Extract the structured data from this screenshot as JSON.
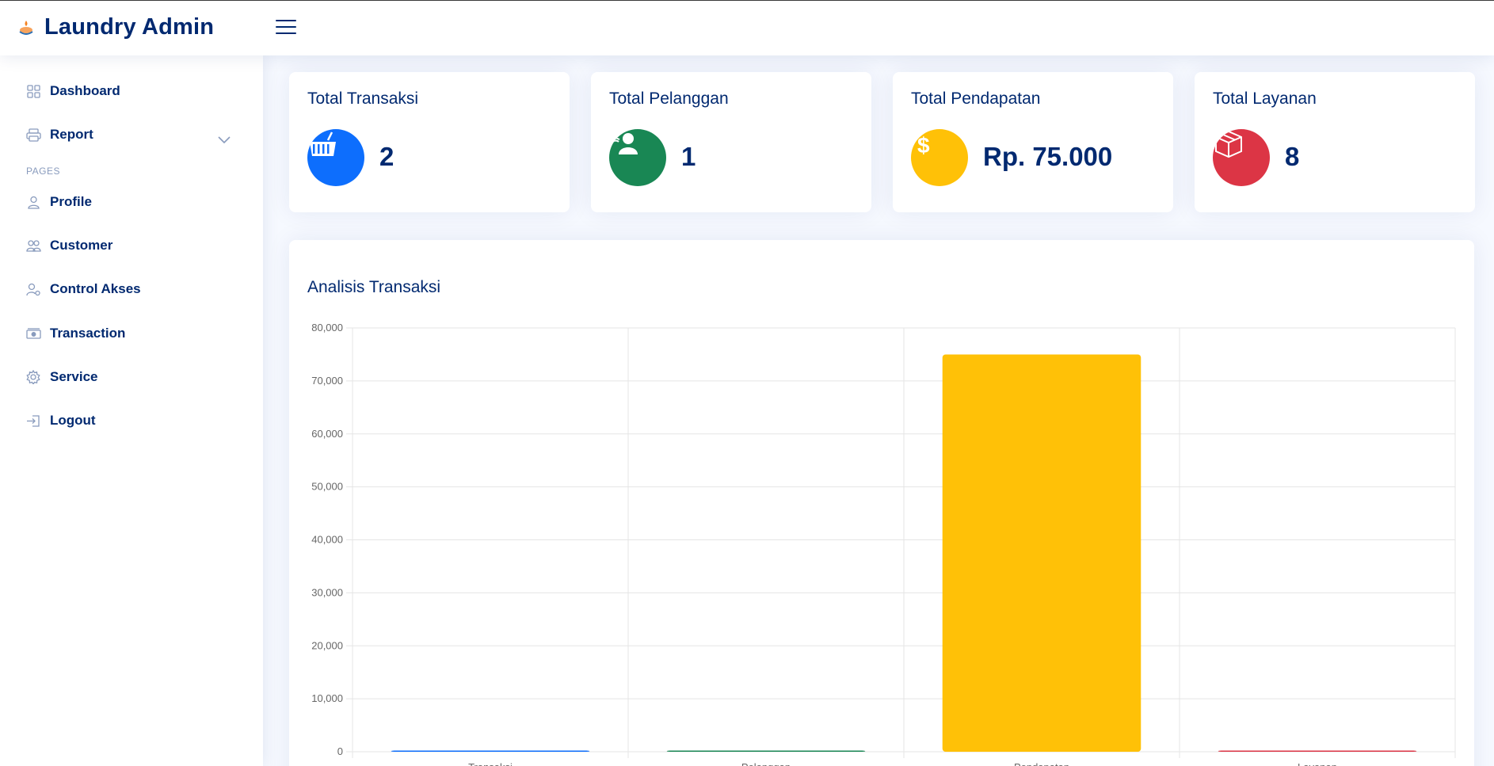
{
  "app": {
    "title": "Laundry Admin"
  },
  "sidebar": {
    "items": [
      {
        "label": "Dashboard",
        "icon": "grid-icon"
      },
      {
        "label": "Report",
        "icon": "printer-icon",
        "has_submenu": true
      },
      {
        "label": "Profile",
        "icon": "person-icon"
      },
      {
        "label": "Customer",
        "icon": "people-icon"
      },
      {
        "label": "Control Akses",
        "icon": "person-gear-icon"
      },
      {
        "label": "Transaction",
        "icon": "cash-icon"
      },
      {
        "label": "Service",
        "icon": "gear-icon"
      },
      {
        "label": "Logout",
        "icon": "box-arrow-in-right-icon"
      }
    ],
    "heading": "Pages"
  },
  "cards": [
    {
      "title": "Total Transaksi",
      "value": "2",
      "color": "#0d6efd",
      "icon": "basket-icon"
    },
    {
      "title": "Total Pelanggan",
      "value": "1",
      "color": "#198754",
      "icon": "person-icon"
    },
    {
      "title": "Total Pendapatan",
      "value": "Rp. 75.000",
      "color": "#ffc107",
      "icon": "dollar-icon"
    },
    {
      "title": "Total Layanan",
      "value": "8",
      "color": "#dc3545",
      "icon": "box-icon"
    }
  ],
  "chart": {
    "title": "Analisis Transaksi"
  },
  "chart_data": {
    "type": "bar",
    "categories": [
      "Transaksi",
      "Pelanggan",
      "Pendapatan",
      "Layanan"
    ],
    "values": [
      2,
      1,
      75000,
      8
    ],
    "colors": [
      "#0d6efd",
      "#198754",
      "#ffc107",
      "#dc3545"
    ],
    "ylim": [
      0,
      80000
    ],
    "yticks": [
      "0",
      "10,000",
      "20,000",
      "30,000",
      "40,000",
      "50,000",
      "60,000",
      "70,000",
      "80,000"
    ],
    "grid": true
  }
}
